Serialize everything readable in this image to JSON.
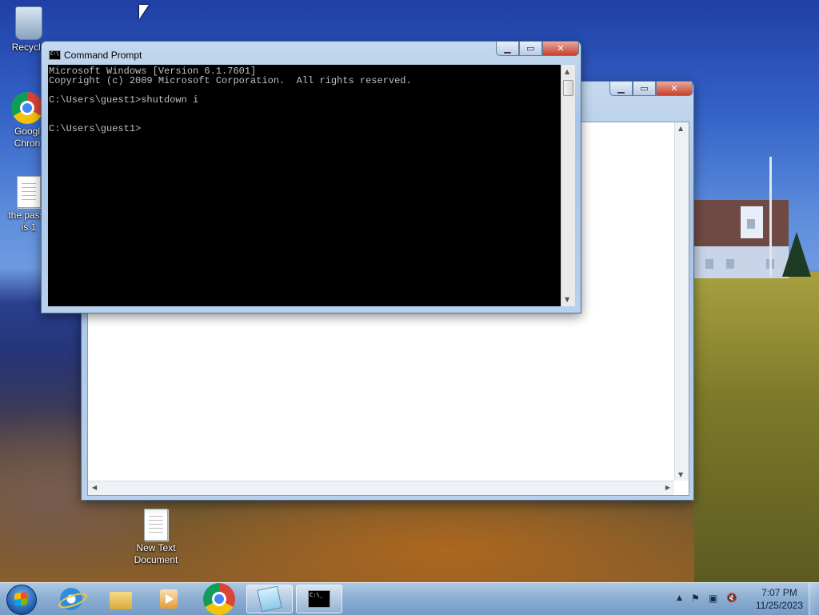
{
  "desktop": {
    "icons": [
      {
        "label": "Recycle",
        "icon": "recycle-bin-icon"
      },
      {
        "label": "Googl\nChron",
        "icon": "chrome-icon"
      },
      {
        "label": "the passv\nis 1",
        "icon": "text-file-icon"
      },
      {
        "label": "New Text\nDocument",
        "icon": "text-file-icon"
      }
    ]
  },
  "cmd_window": {
    "title": "Command Prompt",
    "console_text": "Microsoft Windows [Version 6.1.7601]\nCopyright (c) 2009 Microsoft Corporation.  All rights reserved.\n\nC:\\Users\\guest1>shutdown i\n\n\nC:\\Users\\guest1>",
    "buttons": {
      "minimize": "▁",
      "maximize": "▭",
      "close": "✕"
    }
  },
  "bg_window": {
    "buttons": {
      "minimize": "▁",
      "maximize": "▭",
      "close": "✕"
    }
  },
  "taskbar": {
    "items": [
      {
        "name": "internet-explorer",
        "icon": "ie-icon"
      },
      {
        "name": "file-explorer",
        "icon": "folder-icon"
      },
      {
        "name": "media-player",
        "icon": "media-player-icon"
      },
      {
        "name": "chrome",
        "icon": "chrome-icon"
      },
      {
        "name": "notepad",
        "icon": "notepad-icon",
        "active": true
      },
      {
        "name": "command-prompt",
        "icon": "cmd-icon",
        "active": true
      }
    ],
    "tray": {
      "show_hidden": "▲",
      "flag": "⚑",
      "network": "▣",
      "volume": "🔇",
      "time": "7:07 PM",
      "date": "11/25/2023"
    }
  }
}
